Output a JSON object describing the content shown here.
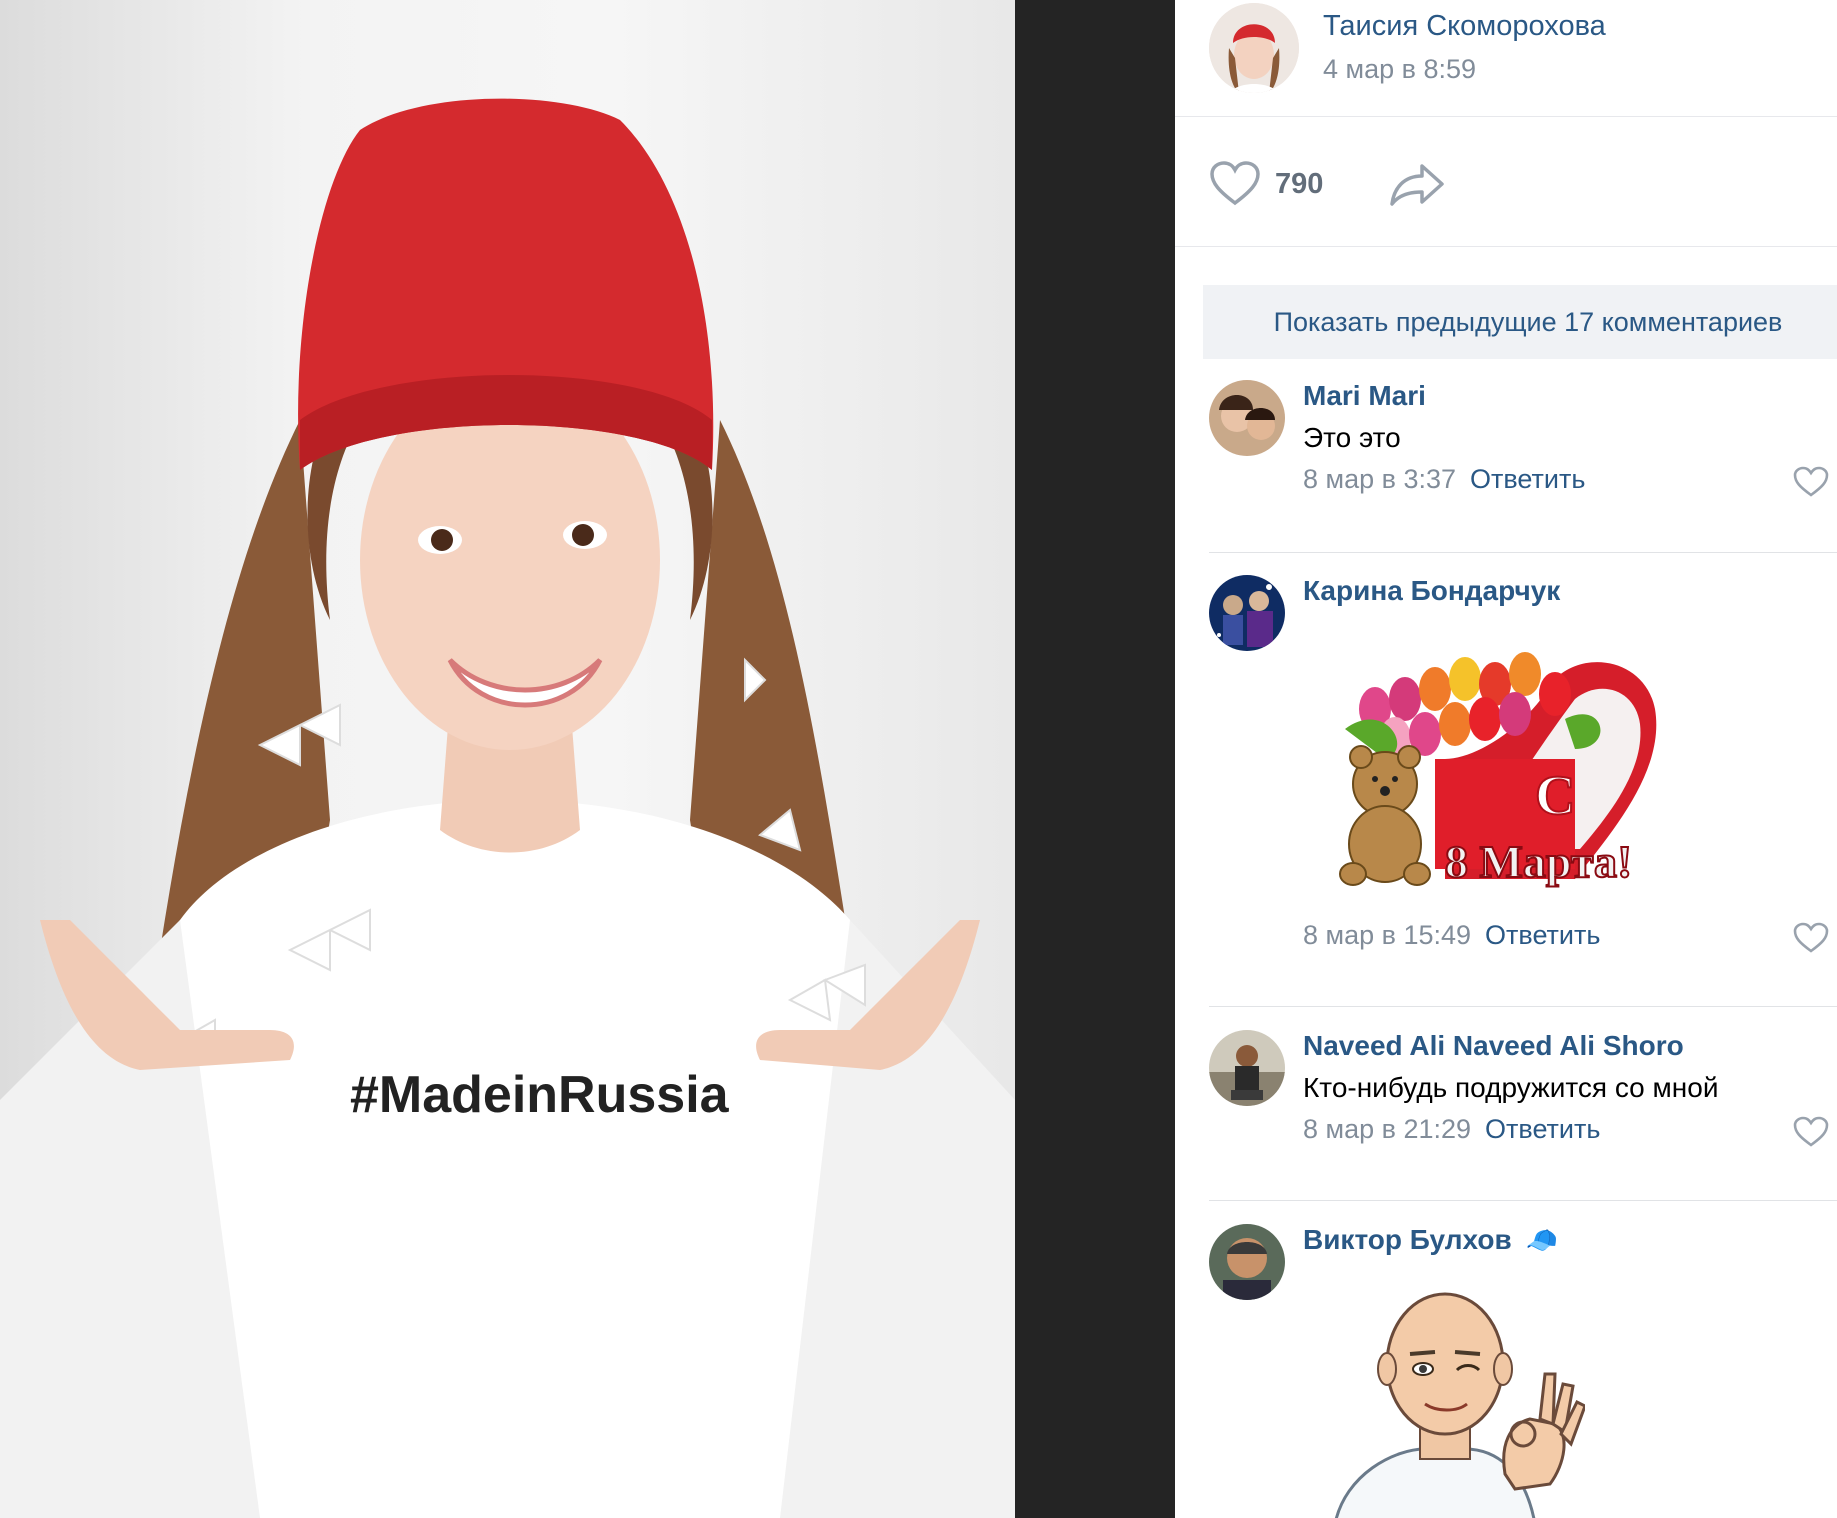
{
  "photo": {
    "shirt_text": "#MadeinRussia"
  },
  "post": {
    "author": "Таисия Скоморохова",
    "date": "4 мар в 8:59",
    "likes": "790"
  },
  "show_previous_label": "Показать предыдущие 17 комментариев",
  "comments": [
    {
      "name": "Mari Mari",
      "text": "Это это",
      "date": "8 мар в 3:37",
      "reply": "Ответить"
    },
    {
      "name": "Карина Бондарчук",
      "sticker_text": "8 Марта!",
      "sticker_c": "С",
      "date": "8 мар в 15:49",
      "reply": "Ответить"
    },
    {
      "name": "Naveed Ali Naveed Ali Shoro",
      "text": "Кто-нибудь подружится со мной",
      "date": "8 мар в 21:29",
      "reply": "Ответить"
    },
    {
      "name": "Виктор Булхов",
      "badge": "🧢"
    }
  ],
  "colors": {
    "link": "#2a5885",
    "meta": "#818c99",
    "divider": "#e1e3e6",
    "hat": "#d42a2e"
  },
  "icons": [
    "heart-icon",
    "share-icon",
    "avatar-image",
    "sticker-image"
  ]
}
